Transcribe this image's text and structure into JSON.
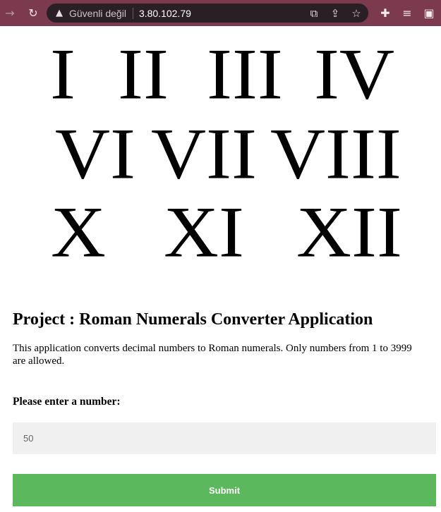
{
  "browser": {
    "security_text": "Güvenli değil",
    "url": "3.80.102.79",
    "icons": [
      "back-arrow-icon",
      "reload-icon",
      "warning-icon",
      "translate-icon",
      "share-icon",
      "star-icon",
      "extensions-icon",
      "media-icon",
      "side-panel-icon"
    ]
  },
  "hero": {
    "numerals": [
      "I",
      "II",
      "III",
      "IV",
      "VI",
      "VII",
      "VIII",
      "X",
      "XI",
      "XII"
    ]
  },
  "main": {
    "title": "Project : Roman Numerals Converter Application",
    "description": "This application converts decimal numbers to Roman numerals. Only numbers from 1 to 3999 are allowed.",
    "input_label": "Please enter a number:",
    "input_value": "50",
    "submit_label": "Submit"
  },
  "colors": {
    "toolbar": "#7b3a4e",
    "submit": "#5cb85c",
    "input_bg": "#f0f0f0"
  }
}
